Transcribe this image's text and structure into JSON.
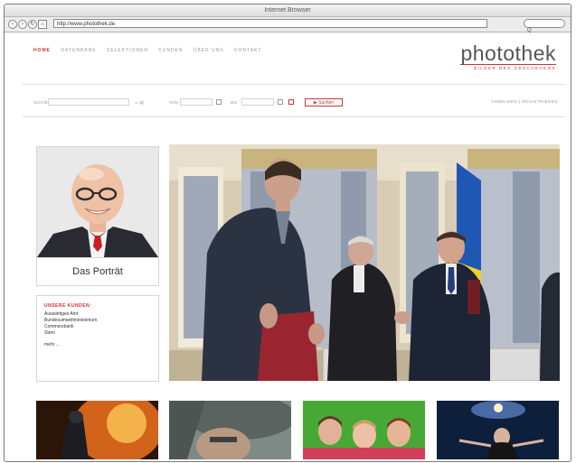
{
  "browser": {
    "title": "Internet Browser",
    "url": "http://www.photothek.de",
    "search_glyph": "Q"
  },
  "site": {
    "nav": [
      "HOME",
      "DATENBANK",
      "SELEKTIONEN",
      "KUNDEN",
      "ÜBER UNS",
      "KONTAKT"
    ],
    "logo_name": "photothek",
    "logo_tagline": "BILDER DES GESCHEHENS",
    "search": {
      "label": "SUCHE",
      "label_von": "VON",
      "label_bis": "BIS",
      "button": "▶ Suchen",
      "account": "ANMELDEN | REGISTRIEREN"
    },
    "portrait_caption": "Das Porträt",
    "kunden": {
      "heading": "UNSERE KUNDEN:",
      "items": [
        "Auswärtiges Amt",
        "Bundesumweltministerium",
        "Commerzbank",
        "Stern"
      ],
      "more": "mehr ..."
    }
  },
  "colors": {
    "accent": "#cc3333",
    "nav_text": "#999999",
    "logo_text": "#555555"
  },
  "icons": [
    "back-icon",
    "forward-icon",
    "reload-icon",
    "home-icon",
    "search-icon",
    "calendar-icon"
  ]
}
